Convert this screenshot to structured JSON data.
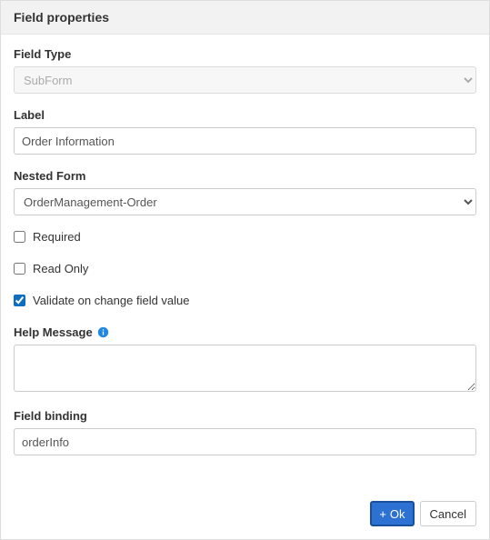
{
  "dialog": {
    "title": "Field properties"
  },
  "fields": {
    "fieldType": {
      "label": "Field Type",
      "value": "SubForm"
    },
    "label": {
      "label": "Label",
      "value": "Order Information"
    },
    "nestedForm": {
      "label": "Nested Form",
      "value": "OrderManagement-Order"
    },
    "required": {
      "label": "Required",
      "checked": false
    },
    "readOnly": {
      "label": "Read Only",
      "checked": false
    },
    "validateOnChange": {
      "label": "Validate on change field value",
      "checked": true
    },
    "helpMessage": {
      "label": "Help Message",
      "value": ""
    },
    "fieldBinding": {
      "label": "Field binding",
      "value": "orderInfo"
    }
  },
  "buttons": {
    "ok": "Ok",
    "cancel": "Cancel"
  },
  "icons": {
    "plus": "+"
  }
}
